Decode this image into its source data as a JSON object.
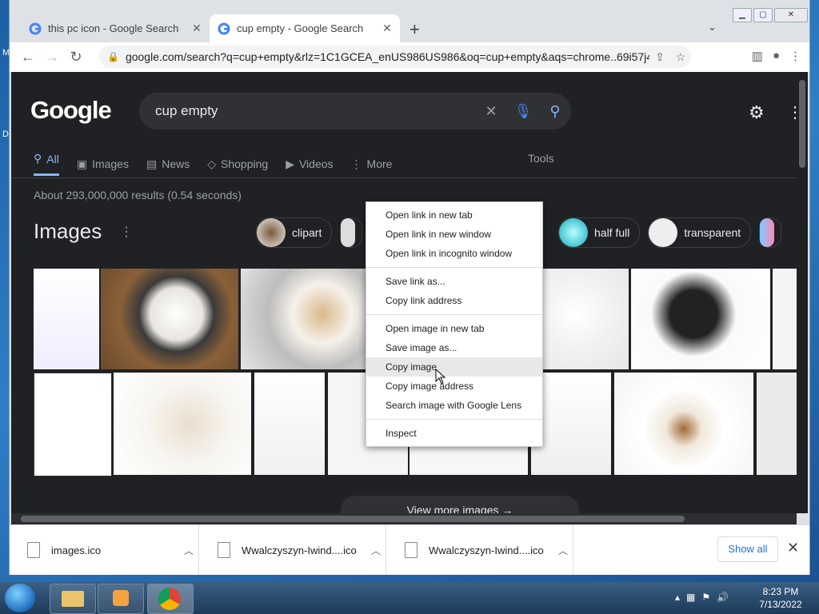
{
  "browser": {
    "tabs": [
      {
        "title": "this pc icon - Google Search",
        "active": false
      },
      {
        "title": "cup empty - Google Search",
        "active": true
      }
    ],
    "url": "google.com/search?q=cup+empty&rlz=1C1GCEA_enUS986US986&oq=cup+empty&aqs=chrome..69i57j46i..."
  },
  "google": {
    "logo": "Google",
    "query": "cup empty",
    "nav": [
      {
        "label": "All",
        "icon": "search-icon",
        "active": true
      },
      {
        "label": "Images",
        "icon": "image-icon",
        "active": false
      },
      {
        "label": "News",
        "icon": "news-icon",
        "active": false
      },
      {
        "label": "Shopping",
        "icon": "tag-icon",
        "active": false
      },
      {
        "label": "Videos",
        "icon": "play-icon",
        "active": false
      },
      {
        "label": "More",
        "icon": "more-icon",
        "active": false
      }
    ],
    "tools": "Tools",
    "stats": "About 293,000,000 results (0.54 seconds)",
    "images_heading": "Images",
    "chips": [
      "clipart",
      "half full",
      "transparent"
    ],
    "view_more": "View more images"
  },
  "context_menu": {
    "groups": [
      [
        "Open link in new tab",
        "Open link in new window",
        "Open link in incognito window"
      ],
      [
        "Save link as...",
        "Copy link address"
      ],
      [
        "Open image in new tab",
        "Save image as...",
        "Copy image",
        "Copy image address",
        "Search image with Google Lens"
      ],
      [
        "Inspect"
      ]
    ],
    "highlighted": "Copy image"
  },
  "downloads": {
    "items": [
      "images.ico",
      "Wwalczyszyn-Iwind....ico",
      "Wwalczyszyn-Iwind....ico"
    ],
    "show_all": "Show all"
  },
  "taskbar": {
    "time": "8:23 PM",
    "date": "7/13/2022"
  },
  "colors": {
    "page_bg": "#202124",
    "link_blue": "#8ab4f8",
    "accent_blue": "#1a73e8"
  }
}
